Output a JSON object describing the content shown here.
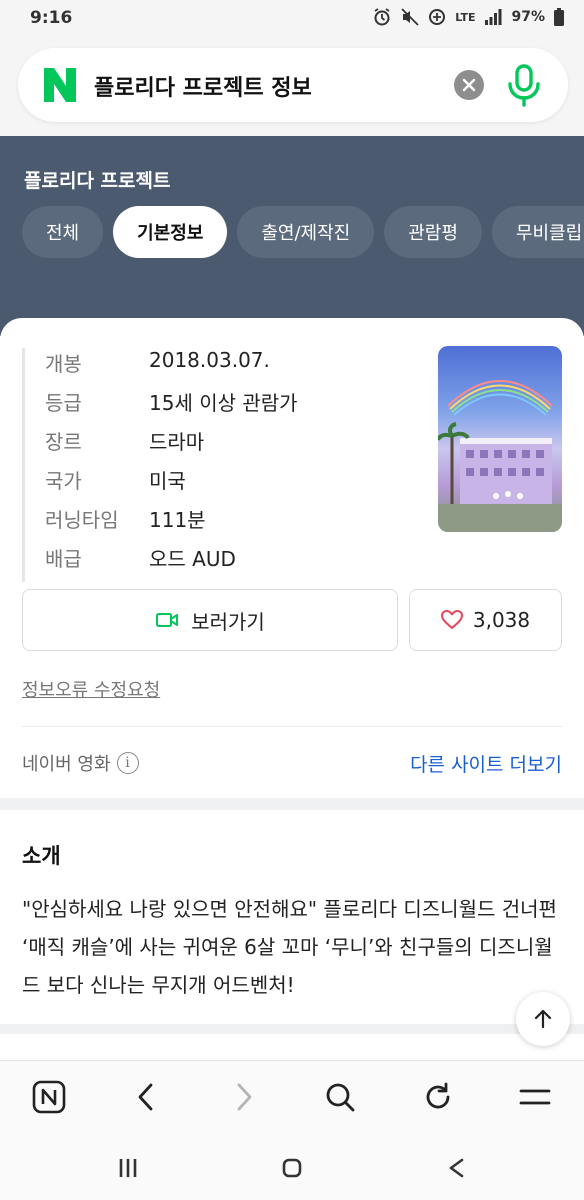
{
  "status_bar": {
    "time": "9:16",
    "network": "LTE",
    "battery": "97%",
    "icons": [
      "alarm-icon",
      "mute-icon",
      "data-saver-icon",
      "signal-icon",
      "battery-icon"
    ]
  },
  "search": {
    "logo": "N",
    "query": "플로리다 프로젝트 정보",
    "brand_color": "#03c75a"
  },
  "header": {
    "title": "플로리다 프로젝트",
    "tabs": [
      {
        "label": "전체"
      },
      {
        "label": "기본정보"
      },
      {
        "label": "출연/제작진"
      },
      {
        "label": "관람평"
      },
      {
        "label": "무비클립"
      }
    ],
    "active_tab": "기본정보"
  },
  "info": {
    "rows": [
      {
        "label": "개봉",
        "value": "2018.03.07."
      },
      {
        "label": "등급",
        "value": "15세 이상 관람가"
      },
      {
        "label": "장르",
        "value": "드라마"
      },
      {
        "label": "국가",
        "value": "미국"
      },
      {
        "label": "러닝타임",
        "value": "111분"
      },
      {
        "label": "배급",
        "value": "오드 AUD"
      }
    ],
    "watch_label": "보러가기",
    "like_count": "3,038",
    "report_label": "정보오류 수정요청",
    "source_label": "네이버 영화",
    "more_sites_label": "다른 사이트 더보기"
  },
  "intro": {
    "heading": "소개",
    "body": "\"안심하세요 나랑 있으면 안전해요\" 플로리다 디즈니월드 건너편 ‘매직 캐슬’에 사는 귀여운 6살 꼬마 ‘무니’와 친구들의 디즈니월드 보다 신나는 무지개 어드벤처!"
  },
  "browser_bar": {
    "icons": [
      "naver-home-icon",
      "back-icon",
      "forward-icon",
      "search-icon",
      "refresh-icon",
      "menu-icon"
    ]
  },
  "system_nav": {
    "icons": [
      "recent-apps-icon",
      "home-icon",
      "back-icon"
    ]
  },
  "colors": {
    "header_bg": "#4c5a6f",
    "link_blue": "#1a5fd0",
    "heart_red": "#e8465a",
    "watch_green": "#03c75a"
  }
}
